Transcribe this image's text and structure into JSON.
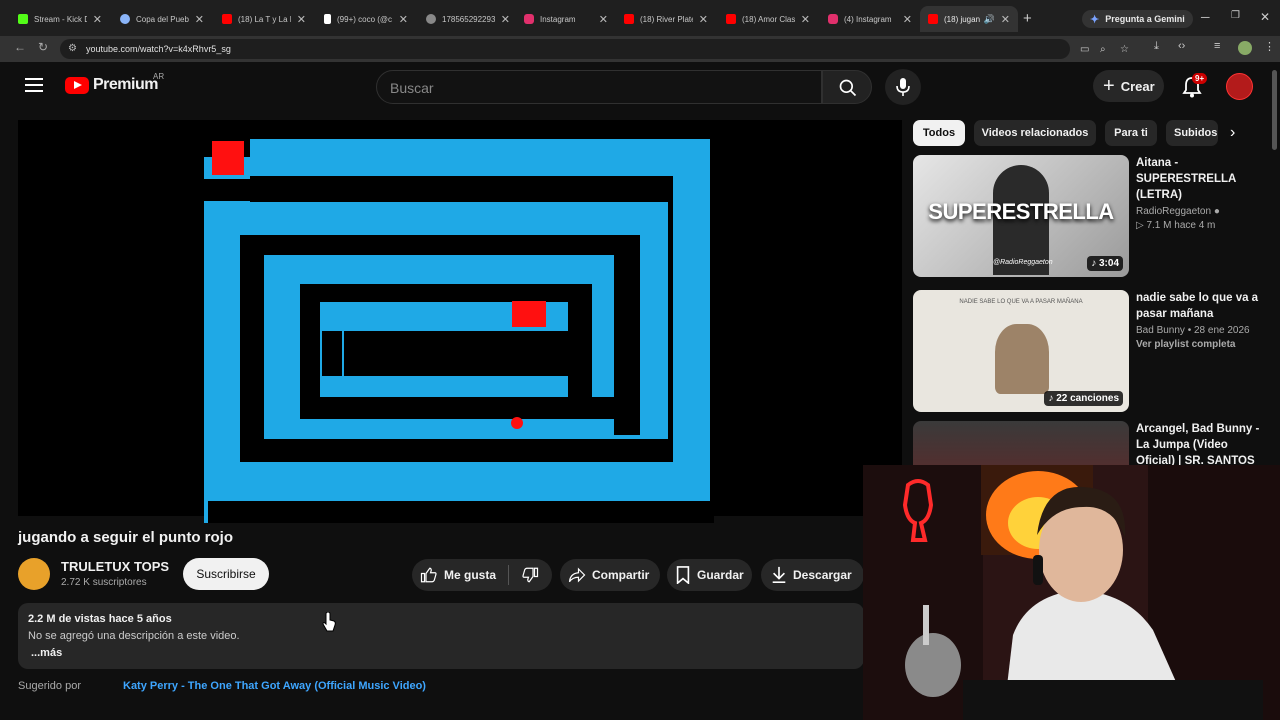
{
  "browser": {
    "tabs": [
      {
        "label": "Stream - Kick D",
        "fav": "#53fc18"
      },
      {
        "label": "Copa del Puebl",
        "fav": "#8ab4f8"
      },
      {
        "label": "(18) La T y La M",
        "fav": "#ff0000"
      },
      {
        "label": "(99+) coco (@c",
        "fav": "#ffffff"
      },
      {
        "label": "178565292293",
        "fav": "#aaaaaa"
      },
      {
        "label": "Instagram",
        "fav": "#e1306c"
      },
      {
        "label": "(18) River Plate",
        "fav": "#ff0000"
      },
      {
        "label": "(18) Amor Clas",
        "fav": "#ff0000"
      },
      {
        "label": "(4) Instagram",
        "fav": "#e1306c"
      },
      {
        "label": "(18) jugand",
        "fav": "#ff0000"
      }
    ],
    "gemini_label": "Pregunta a Gemini",
    "url": "youtube.com/watch?v=k4xRhvr5_sg"
  },
  "header": {
    "logo_text": "Premium",
    "region": "AR",
    "search_placeholder": "Buscar",
    "create_label": "Crear",
    "notif_badge": "9+"
  },
  "video": {
    "title": "jugando a seguir el punto rojo",
    "channel": "TRULETUX TOPS",
    "subscribers": "2.72 K suscriptores",
    "subscribe_label": "Suscribirse",
    "like_label": "Me gusta",
    "share_label": "Compartir",
    "save_label": "Guardar",
    "download_label": "Descargar",
    "views_date": "2.2 M de vistas  hace 5 años",
    "description": "No se agregó una descripción a este video.",
    "more_label": "...más",
    "suggested_label": "Sugerido por",
    "suggested_link": "Katy Perry - The One That Got Away (Official Music Video)"
  },
  "sidebar": {
    "chips": [
      "Todos",
      "Videos relacionados",
      "Para ti",
      "Subidos"
    ],
    "items": [
      {
        "title": "Aitana - SUPERESTRELLA (LETRA)",
        "channel": "RadioReggaeton",
        "stats": "7.1 M  hace 4 m",
        "duration": "3:04",
        "thumb_text": "SUPERESTRELLA",
        "thumb_sub": "@RadioReggaeton"
      },
      {
        "title": "nadie sabe lo que va a pasar mañana",
        "channel": "Bad Bunny • 28 ene 2026",
        "stats": "Ver playlist completa",
        "duration": "22 canciones",
        "thumb_text": "NADIE SABE LO QUE VA A PASAR MAÑANA"
      },
      {
        "title": "Arcangel, Bad Bunny - La Jumpa (Video Oficial) | SR. SANTOS"
      }
    ]
  },
  "colors": {
    "maze_blue": "#1fa9e6",
    "dot_red": "#ff1010",
    "link_blue": "#3ea6ff"
  }
}
